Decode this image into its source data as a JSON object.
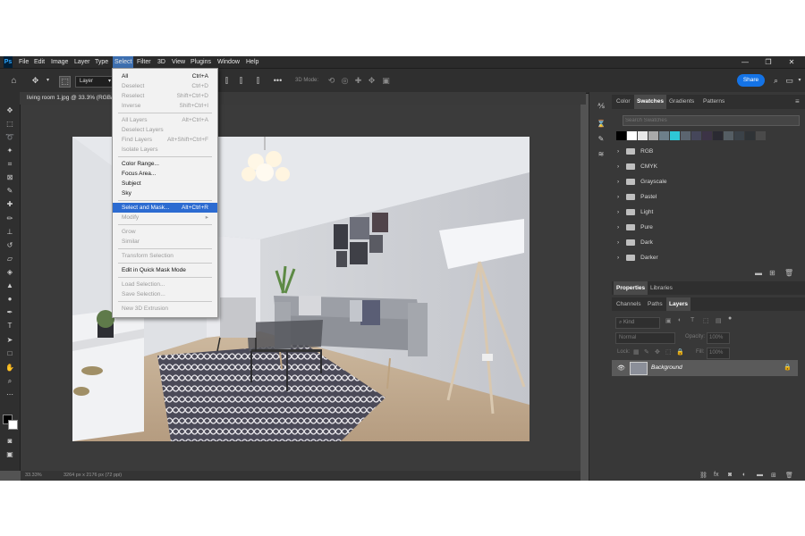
{
  "menubar": {
    "app_icon": "Ps",
    "items": [
      "File",
      "Edit",
      "Image",
      "Layer",
      "Type",
      "Select",
      "Filter",
      "3D",
      "View",
      "Plugins",
      "Window",
      "Help"
    ],
    "active": "Select",
    "window_controls": [
      "minimize-icon",
      "restore-icon",
      "close-icon"
    ]
  },
  "options_bar": {
    "auto_select_value": "Layer",
    "mode_3d_label": "3D Mode:",
    "share_label": "Share"
  },
  "document": {
    "tab_title": "living room 1.jpg @ 33.3% (RGB/8)",
    "status_zoom": "33.33%",
    "status_info": "3264 px x 2176 px (72 ppi)"
  },
  "select_menu": {
    "groups": [
      [
        {
          "label": "All",
          "shortcut": "Ctrl+A",
          "enabled": true
        },
        {
          "label": "Deselect",
          "shortcut": "Ctrl+D",
          "enabled": false
        },
        {
          "label": "Reselect",
          "shortcut": "Shift+Ctrl+D",
          "enabled": false
        },
        {
          "label": "Inverse",
          "shortcut": "Shift+Ctrl+I",
          "enabled": false
        }
      ],
      [
        {
          "label": "All Layers",
          "shortcut": "Alt+Ctrl+A",
          "enabled": false
        },
        {
          "label": "Deselect Layers",
          "shortcut": "",
          "enabled": false
        },
        {
          "label": "Find Layers",
          "shortcut": "Alt+Shift+Ctrl+F",
          "enabled": false
        },
        {
          "label": "Isolate Layers",
          "shortcut": "",
          "enabled": false
        }
      ],
      [
        {
          "label": "Color Range...",
          "shortcut": "",
          "enabled": true
        },
        {
          "label": "Focus Area...",
          "shortcut": "",
          "enabled": true
        },
        {
          "label": "Subject",
          "shortcut": "",
          "enabled": true
        },
        {
          "label": "Sky",
          "shortcut": "",
          "enabled": true
        }
      ],
      [
        {
          "label": "Select and Mask...",
          "shortcut": "Alt+Ctrl+R",
          "enabled": true,
          "highlighted": true
        },
        {
          "label": "Modify",
          "shortcut": "▸",
          "enabled": false
        }
      ],
      [
        {
          "label": "Grow",
          "shortcut": "",
          "enabled": false
        },
        {
          "label": "Similar",
          "shortcut": "",
          "enabled": false
        }
      ],
      [
        {
          "label": "Transform Selection",
          "shortcut": "",
          "enabled": false
        }
      ],
      [
        {
          "label": "Edit in Quick Mask Mode",
          "shortcut": "",
          "enabled": true
        }
      ],
      [
        {
          "label": "Load Selection...",
          "shortcut": "",
          "enabled": false
        },
        {
          "label": "Save Selection...",
          "shortcut": "",
          "enabled": false
        }
      ],
      [
        {
          "label": "New 3D Extrusion",
          "shortcut": "",
          "enabled": false
        }
      ]
    ]
  },
  "swatches_panel": {
    "tabs": [
      "Color",
      "Swatches",
      "Gradients",
      "Patterns"
    ],
    "active_tab": "Swatches",
    "search_placeholder": "Search Swatches",
    "recent_colors": [
      "#000000",
      "#ffffff",
      "#e8e8e8",
      "#a9a9a9",
      "#6d7f8a",
      "#2ec8d6",
      "#5b6570",
      "#45465a",
      "#3c3346",
      "#2a2a32",
      "#555e64",
      "#3b4248",
      "#2f3336",
      "#4a4a4a",
      "#383838"
    ],
    "folders": [
      "RGB",
      "CMYK",
      "Grayscale",
      "Pastel",
      "Light",
      "Pure",
      "Dark",
      "Darker"
    ]
  },
  "properties_panel": {
    "tabs": [
      "Properties",
      "Libraries"
    ],
    "active_tab": "Properties"
  },
  "layers_panel": {
    "tabs": [
      "Channels",
      "Paths",
      "Layers"
    ],
    "active_tab": "Layers",
    "filter_label": "Kind",
    "blend_mode": "Normal",
    "opacity_label": "Opacity:",
    "opacity_value": "100%",
    "lock_label": "Lock:",
    "fill_label": "Fill:",
    "fill_value": "100%",
    "layers": [
      {
        "name": "Background",
        "visible": true,
        "locked": true
      }
    ]
  },
  "colors": {
    "menu_highlight": "#2c6bd1",
    "share_button": "#1473e6",
    "app_background": "#535353"
  }
}
